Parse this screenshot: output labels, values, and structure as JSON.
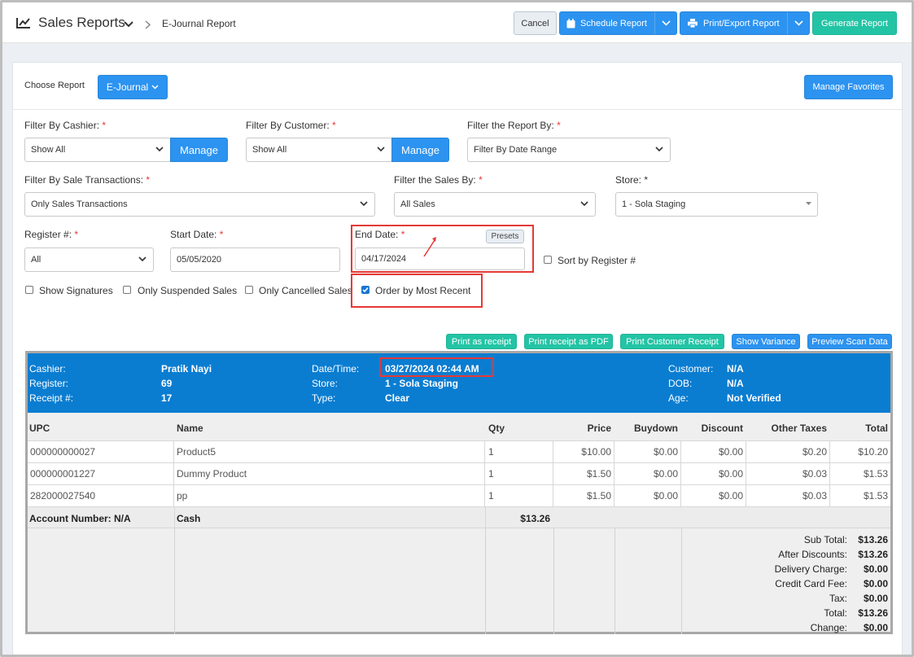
{
  "header": {
    "title": "Sales Reports",
    "breadcrumb": "E-Journal Report",
    "cancel": "Cancel",
    "schedule": "Schedule Report",
    "print_export": "Print/Export Report",
    "generate": "Generate Report"
  },
  "choose": {
    "label": "Choose Report",
    "report": "E-Journal",
    "favorites": "Manage Favorites"
  },
  "filters": {
    "cashier_label": "Filter By Cashier:",
    "cashier_value": "Show All",
    "customer_label": "Filter By Customer:",
    "customer_value": "Show All",
    "manage": "Manage",
    "report_by_label": "Filter the Report By:",
    "report_by_value": "Filter By Date Range",
    "sale_tx_label": "Filter By Sale Transactions:",
    "sale_tx_value": "Only Sales Transactions",
    "sales_by_label": "Filter the Sales By:",
    "sales_by_value": "All Sales",
    "store_label": "Store:",
    "store_value": "1 - Sola Staging",
    "register_label": "Register #:",
    "register_value": "All",
    "start_label": "Start Date:",
    "start_value": "05/05/2020",
    "end_label": "End Date:",
    "end_value": "04/17/2024",
    "presets": "Presets",
    "sort_register": "Sort by Register #",
    "show_signatures": "Show Signatures",
    "only_suspended": "Only Suspended Sales",
    "only_cancelled": "Only Cancelled Sales",
    "order_recent": "Order by Most Recent",
    "required_mark": "*",
    "store_mark": "*"
  },
  "actions": {
    "print_receipt": "Print as receipt",
    "print_pdf": "Print receipt as PDF",
    "print_customer": "Print Customer Receipt",
    "show_variance": "Show Variance",
    "preview_scan": "Preview Scan Data"
  },
  "receipt": {
    "cashier_k": "Cashier:",
    "cashier_v": "Pratik Nayi",
    "register_k": "Register:",
    "register_v": "69",
    "receipt_k": "Receipt #:",
    "receipt_v": "17",
    "datetime_k": "Date/Time:",
    "datetime_v": "03/27/2024 02:44 AM",
    "store_k": "Store:",
    "store_v": "1 - Sola Staging",
    "type_k": "Type:",
    "type_v": "Clear",
    "customer_k": "Customer:",
    "customer_v": "N/A",
    "dob_k": "DOB:",
    "dob_v": "N/A",
    "age_k": "Age:",
    "age_v": "Not Verified",
    "columns": {
      "upc": "UPC",
      "name": "Name",
      "qty": "Qty",
      "price": "Price",
      "buydown": "Buydown",
      "discount": "Discount",
      "other": "Other Taxes",
      "total": "Total"
    },
    "items": [
      {
        "upc": "000000000027",
        "name": "Product5",
        "qty": "1",
        "price": "$10.00",
        "buydown": "$0.00",
        "discount": "$0.00",
        "other": "$0.20",
        "total": "$10.20"
      },
      {
        "upc": "000000001227",
        "name": "Dummy Product",
        "qty": "1",
        "price": "$1.50",
        "buydown": "$0.00",
        "discount": "$0.00",
        "other": "$0.03",
        "total": "$1.53"
      },
      {
        "upc": "282000027540",
        "name": "pp",
        "qty": "1",
        "price": "$1.50",
        "buydown": "$0.00",
        "discount": "$0.00",
        "other": "$0.03",
        "total": "$1.53"
      }
    ],
    "account": "Account Number: N/A",
    "tender": "Cash",
    "tender_amount": "$13.26",
    "totals": [
      {
        "k": "Sub Total:",
        "v": "$13.26"
      },
      {
        "k": "After Discounts:",
        "v": "$13.26"
      },
      {
        "k": "Delivery Charge:",
        "v": "$0.00"
      },
      {
        "k": "Credit Card Fee:",
        "v": "$0.00"
      },
      {
        "k": "Tax:",
        "v": "$0.00"
      },
      {
        "k": "Total:",
        "v": "$13.26"
      },
      {
        "k": "Change:",
        "v": "$0.00"
      }
    ]
  },
  "colors": {
    "primary": "#2c93f0",
    "teal": "#23c4a5",
    "receipt_header": "#0a7dd1",
    "highlight": "#e53935"
  }
}
